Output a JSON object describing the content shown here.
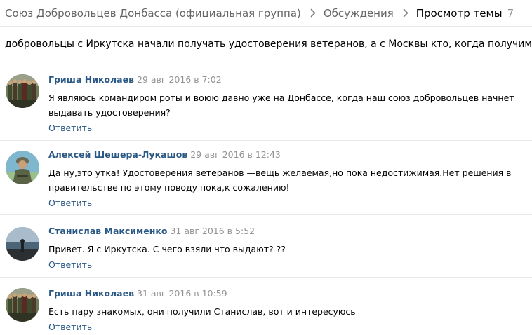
{
  "breadcrumb": {
    "group": "Союз Добровольцев Донбасса (официальная группа)",
    "discussions": "Обсуждения",
    "current": "Просмотр темы",
    "count": "7"
  },
  "topic": {
    "title": "добровольцы с Иркутска начали получать удостоверения ветеранов, а с Москвы кто, когда получим?"
  },
  "posts": [
    {
      "author": "Гриша Николаев",
      "date": "29 авг 2016 в 7:02",
      "text": "Я являюсь командиром роты и воюю давно уже на Донбассе, когда наш союз добровольцев начнет выдавать удостоверения?",
      "reply": "Ответить"
    },
    {
      "author": "Алексей Шешера-Лукашов",
      "date": "29 авг 2016 в 12:43",
      "text": "Да ну,это утка! Удостоверения ветеранов —вещь желаемая,но пока недостижимая.Нет решения в правительстве по этому поводу пока,к сожалению!",
      "reply": "Ответить"
    },
    {
      "author": "Станислав Максименко",
      "date": "31 авг 2016 в 5:52",
      "text": "Привет. Я с Иркутска. С чего взяли что выдают? ??",
      "reply": "Ответить"
    },
    {
      "author": "Гриша Николаев",
      "date": "31 авг 2016 в 10:59",
      "text": "Есть пару знакомых, они получили Станислав, вот и интересуюсь",
      "reply": "Ответить"
    }
  ],
  "colors": {
    "link": "#2a5885",
    "muted": "#939393",
    "breadcrumb": "#656565",
    "divider": "#e7e8ec"
  }
}
